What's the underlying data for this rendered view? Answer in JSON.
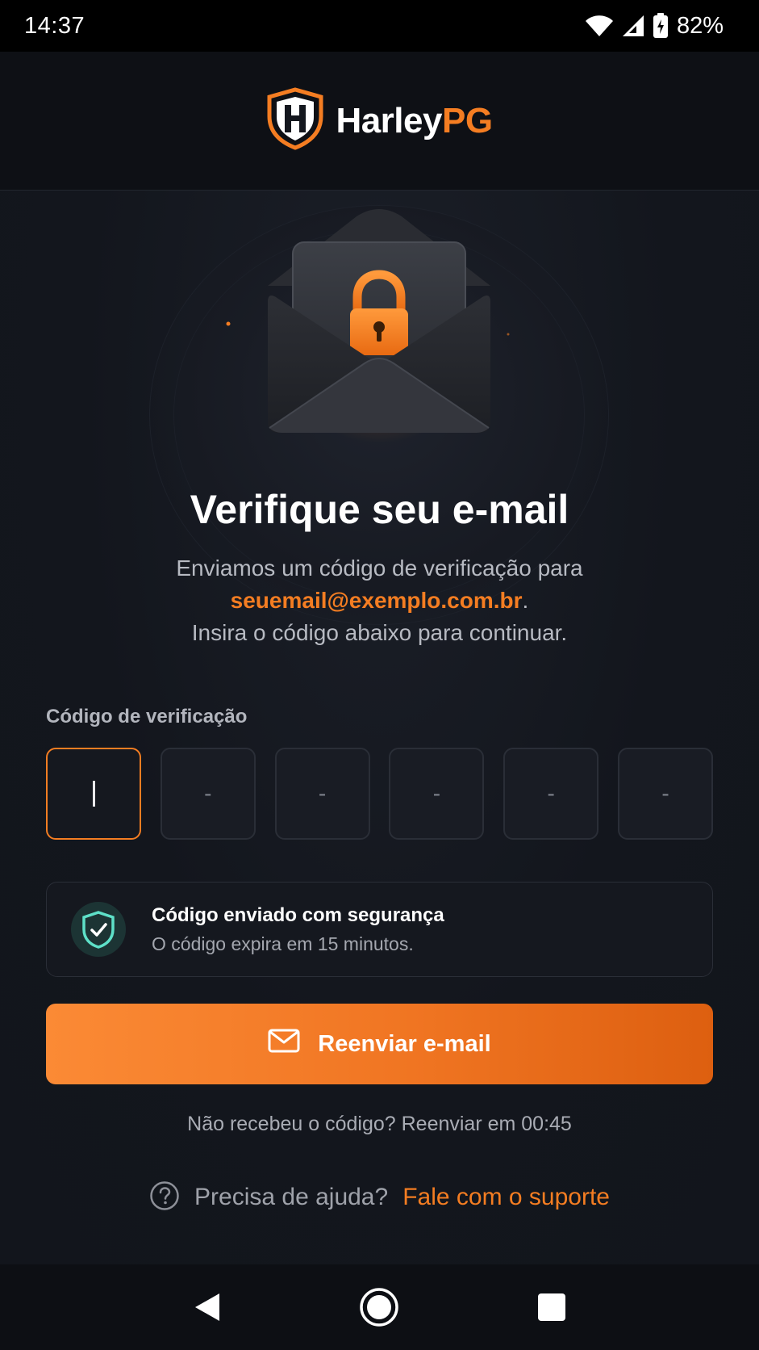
{
  "status_bar": {
    "time": "14:37",
    "battery": "82%",
    "icons": [
      "wifi-icon",
      "signal-icon",
      "battery-charging-icon"
    ]
  },
  "header": {
    "logo_icon": "shield-h-logo-icon",
    "brand_white": "Harley",
    "brand_orange": "PG"
  },
  "hero": {
    "illustration": "envelope-lock-icon"
  },
  "main": {
    "title": "Verifique seu e-mail",
    "desc_line1": "Enviamos um código de verificação para",
    "email": "seuemail@exemplo.com.br",
    "email_suffix": ".",
    "desc_line3": "Insira o código abaixo para continuar."
  },
  "code": {
    "label": "Código de verificação",
    "digits": [
      "",
      "-",
      "-",
      "-",
      "-",
      "-"
    ]
  },
  "info_card": {
    "icon": "shield-check-icon",
    "title": "Código enviado com segurança",
    "subtitle": "O código expira em 15 minutos."
  },
  "resend_button": {
    "icon": "mail-icon",
    "label": "Reenviar e-mail"
  },
  "resend_note": "Não recebeu o código? Reenviar em 00:45",
  "help": {
    "icon": "help-circle-icon",
    "text": "Precisa de ajuda?",
    "link": "Fale com o suporte"
  },
  "nav_bar": {
    "back_icon": "back-triangle-icon",
    "home_icon": "home-circle-icon",
    "recents_icon": "recents-square-icon"
  },
  "colors": {
    "accent": "#f47d22",
    "background": "#13161d",
    "success": "#5ee0c8"
  }
}
